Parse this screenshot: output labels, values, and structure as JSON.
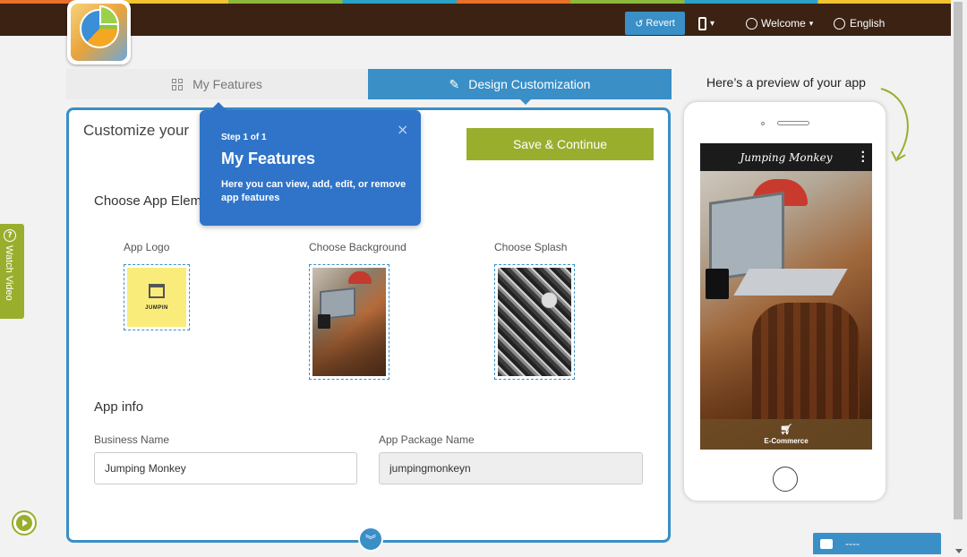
{
  "header": {
    "revert_label": "Revert",
    "device_caret": "▾",
    "welcome_label": "Welcome",
    "language_label": "English"
  },
  "tabs": [
    {
      "label": "My Features",
      "icon": "grid-icon"
    },
    {
      "label": "Design Customization",
      "icon": "edit-icon"
    }
  ],
  "panel": {
    "title": "Customize your",
    "save_label": "Save & Continue",
    "elements_heading": "Choose App Elem",
    "elements": [
      {
        "label": "App Logo",
        "logo_text": "JUMPIN"
      },
      {
        "label": "Choose Background"
      },
      {
        "label": "Choose Splash"
      }
    ],
    "info_heading": "App info",
    "business_name": {
      "label": "Business Name",
      "value": "Jumping Monkey"
    },
    "package_name": {
      "label": "App Package Name",
      "value": "jumpingmonkeyn"
    }
  },
  "tooltip": {
    "step": "Step 1 of 1",
    "title": "My Features",
    "body": "Here you can view, add, edit, or remove app features",
    "close": "×"
  },
  "watch_video_label": "Watch Video",
  "preview": {
    "heading": "Here’s a preview of your app",
    "app_title": "Jumping Monkey",
    "footer_label": "E-Commerce"
  },
  "chat": {
    "label": "----"
  },
  "colors": {
    "accent_blue": "#3a8fc7",
    "accent_green": "#9aae2e",
    "topbar": "#3b2213"
  }
}
